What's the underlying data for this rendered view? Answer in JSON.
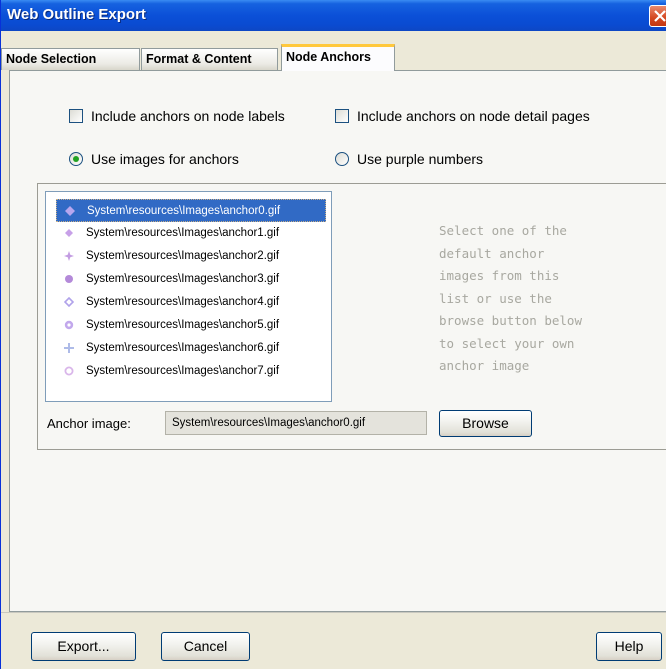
{
  "window": {
    "title": "Web Outline Export"
  },
  "tabs": [
    {
      "label": "Node Selection",
      "active": false
    },
    {
      "label": "Format & Content",
      "active": false
    },
    {
      "label": "Node Anchors",
      "active": true
    }
  ],
  "options": {
    "include_anchors_labels": {
      "label": "Include anchors on node labels",
      "checked": false
    },
    "include_anchors_detail": {
      "label": "Include anchors on node detail pages",
      "checked": false
    },
    "use_images": {
      "label": "Use images for anchors",
      "selected": true
    },
    "use_purple": {
      "label": "Use purple numbers",
      "selected": false
    }
  },
  "anchor_list": {
    "items": [
      "System\\resources\\Images\\anchor0.gif",
      "System\\resources\\Images\\anchor1.gif",
      "System\\resources\\Images\\anchor2.gif",
      "System\\resources\\Images\\anchor3.gif",
      "System\\resources\\Images\\anchor4.gif",
      "System\\resources\\Images\\anchor5.gif",
      "System\\resources\\Images\\anchor6.gif",
      "System\\resources\\Images\\anchor7.gif"
    ],
    "selected_index": 0,
    "icon_colors": [
      "#b7a6ee",
      "#c7a0e8",
      "#c39ce2",
      "#b48ad9",
      "#b0a2ea",
      "#c2a8ec",
      "#aebbe8",
      "#d9b6ea"
    ]
  },
  "hint_text": "Select one of the\ndefault anchor\nimages from this\nlist or use the\nbrowse button below\nto select your own\nanchor image",
  "anchor_image": {
    "label": "Anchor image:",
    "value": "System\\resources\\Images\\anchor0.gif"
  },
  "buttons": {
    "browse": "Browse",
    "export": "Export...",
    "cancel": "Cancel",
    "help": "Help"
  },
  "colors": {
    "titlebar": "#0b50d8",
    "selection": "#316ac5",
    "radio_dot": "#21a121",
    "active_tab_accent": "#ffc83c"
  }
}
